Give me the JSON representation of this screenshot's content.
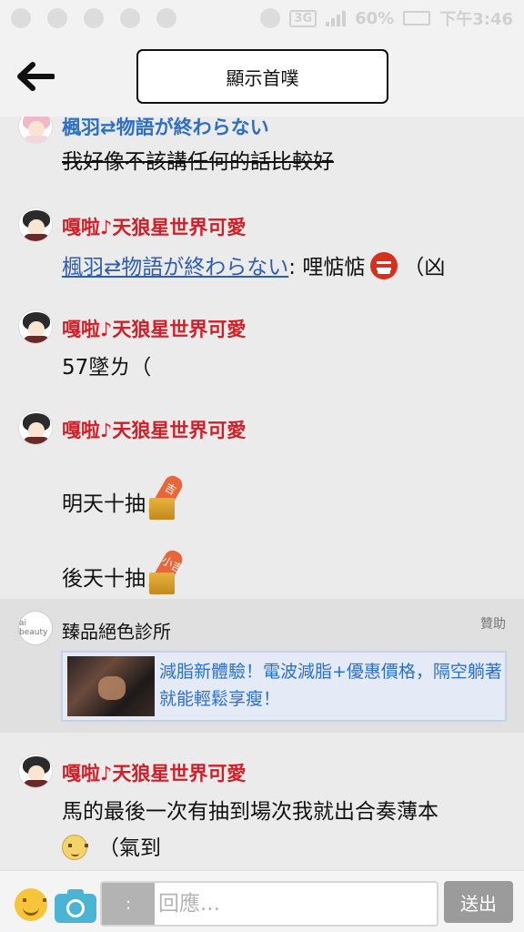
{
  "status_bar": {
    "network": "3G",
    "battery": "60%",
    "time": "下午3:46"
  },
  "header": {
    "title": "顯示首噗"
  },
  "posts": [
    {
      "author": "楓羽⇄物語が終わらない",
      "text": "我好像不該講任何的話比較好"
    },
    {
      "author": "嘎啦♪天狼星世界可愛",
      "mention": "楓羽⇄物語が終わらない",
      "text": ": 哩惦惦",
      "after": "（凶"
    },
    {
      "author": "嘎啦♪天狼星世界可愛",
      "text": "57墜ㄌ（"
    },
    {
      "author": "嘎啦♪天狼星世界可愛",
      "line1": "明天十抽",
      "stick1": "吉",
      "line2": "後天十抽",
      "stick2": "小吉"
    },
    {
      "author": "嘎啦♪天狼星世界可愛",
      "line1": "馬的最後一次有抽到場次我就出合奏薄本",
      "line2": "（氣到"
    }
  ],
  "ad": {
    "logo_text": "ai beauty",
    "name": "臻品絕色診所",
    "tag": "贊助",
    "text": "減脂新體驗！電波減脂+優惠價格，隔空躺著就能輕鬆享瘦！"
  },
  "bottom_bar": {
    "qualifier": ":",
    "reply_placeholder": "回應...",
    "send_label": "送出"
  },
  "colors": {
    "author_red": "#d01f28",
    "author_blue": "#2d6fc2",
    "link": "#2d5db3",
    "ad_text": "#2c6fd0"
  }
}
